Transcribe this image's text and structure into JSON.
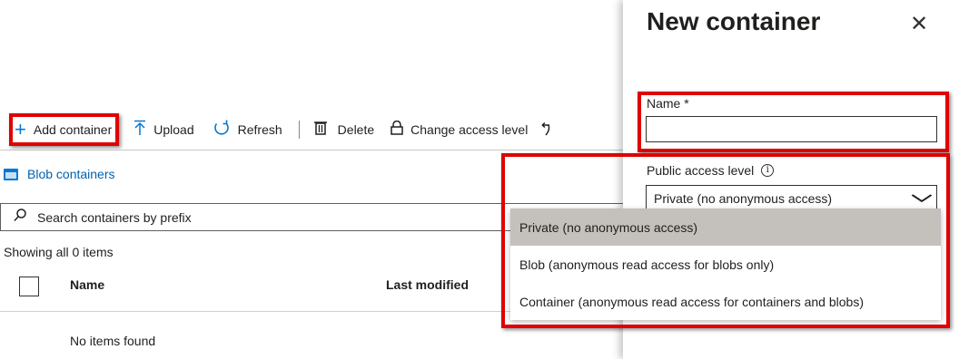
{
  "toolbar": {
    "add_container": "Add container",
    "upload": "Upload",
    "refresh": "Refresh",
    "delete": "Delete",
    "change_access_level": "Change access level"
  },
  "breadcrumb": {
    "label": "Blob containers"
  },
  "search": {
    "placeholder": "Search containers by prefix"
  },
  "list": {
    "showing": "Showing all 0 items",
    "columns": [
      "Name",
      "Last modified"
    ],
    "empty": "No items found"
  },
  "panel": {
    "title": "New container",
    "name_label": "Name *",
    "name_value": "",
    "access_label": "Public access level",
    "access_selected": "Private (no anonymous access)",
    "access_options": [
      "Private (no anonymous access)",
      "Blob (anonymous read access for blobs only)",
      "Container (anonymous read access for containers and blobs)"
    ]
  },
  "colors": {
    "accent": "#0078d4",
    "highlight": "#e00000",
    "link": "#0062ad"
  }
}
